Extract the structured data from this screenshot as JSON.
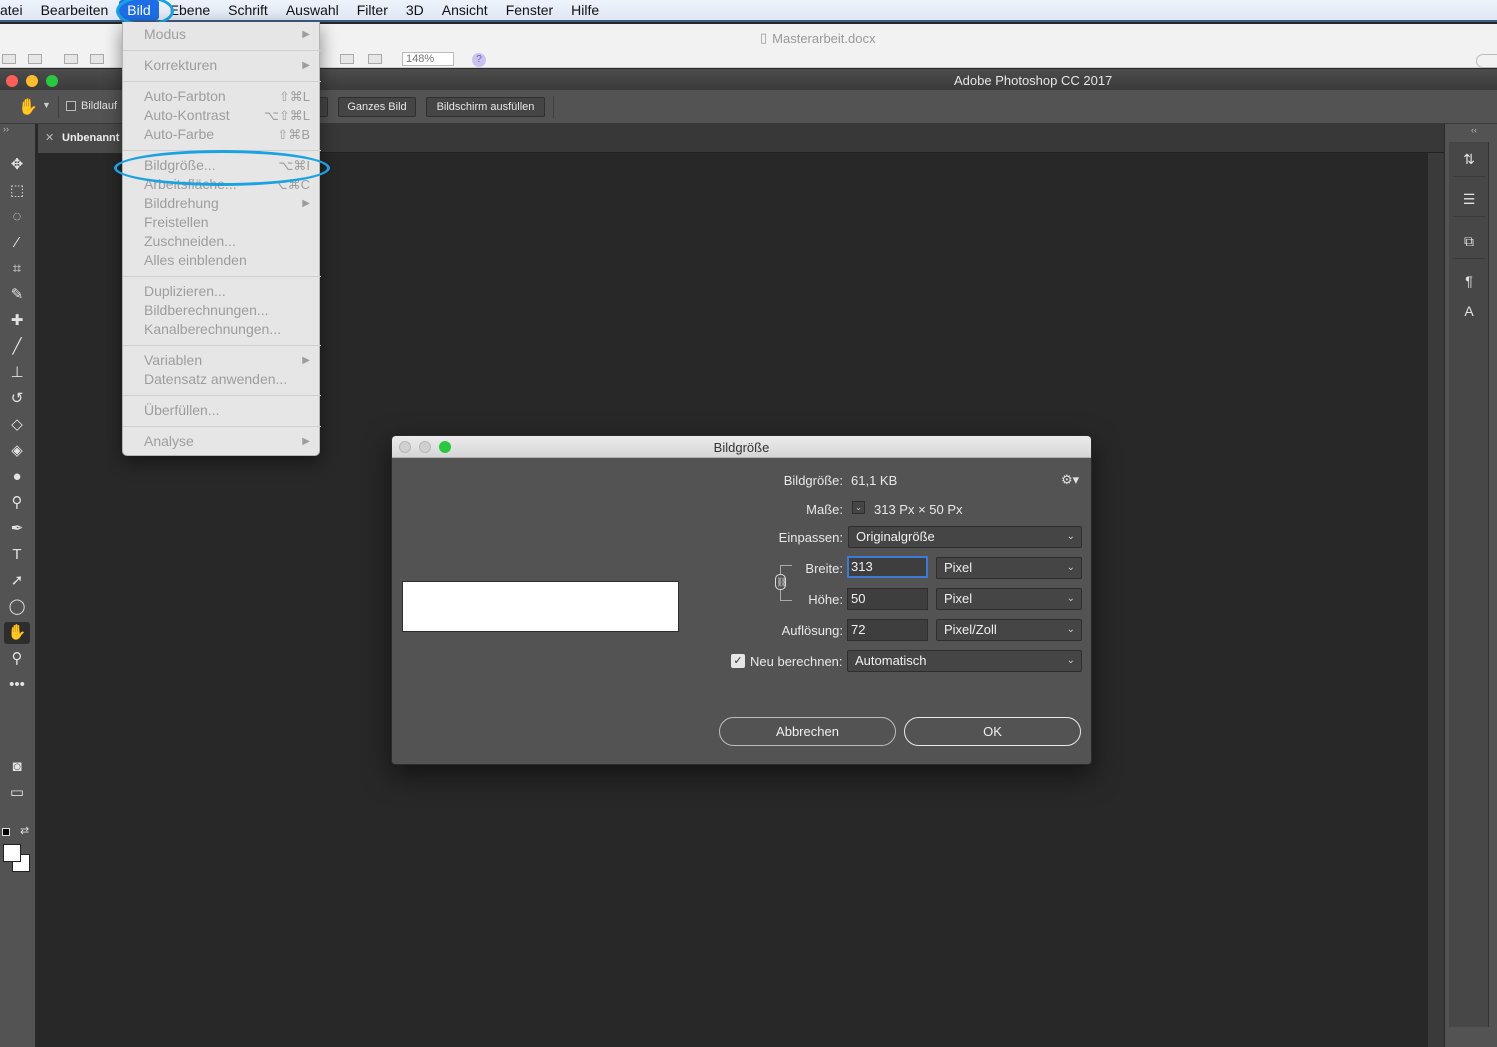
{
  "menubar": {
    "items": [
      "atei",
      "Bearbeiten",
      "Bild",
      "Ebene",
      "Schrift",
      "Auswahl",
      "Filter",
      "3D",
      "Ansicht",
      "Fenster",
      "Hilfe"
    ],
    "active": "Bild"
  },
  "word": {
    "doc_title": "Masterarbeit.docx",
    "zoom": "148%"
  },
  "photoshop": {
    "title": "Adobe Photoshop CC 2017"
  },
  "options_bar": {
    "bildlauf_label": "Bildlauf",
    "btn_ganzes_bild": "Ganzes Bild",
    "btn_bildschirm": "Bildschirm ausfüllen"
  },
  "document_tab": {
    "label": "Unbenannt"
  },
  "bild_menu": {
    "items": [
      {
        "label": "Modus",
        "submenu": true
      },
      {
        "label": "Korrekturen",
        "submenu": true
      },
      {
        "label": "Auto-Farbton",
        "shortcut": "⇧⌘L"
      },
      {
        "label": "Auto-Kontrast",
        "shortcut": "⌥⇧⌘L"
      },
      {
        "label": "Auto-Farbe",
        "shortcut": "⇧⌘B"
      },
      {
        "label": "Bildgröße...",
        "shortcut": "⌥⌘I"
      },
      {
        "label": "Arbeitsfläche...",
        "shortcut": "⌥⌘C"
      },
      {
        "label": "Bilddrehung",
        "submenu": true
      },
      {
        "label": "Freistellen"
      },
      {
        "label": "Zuschneiden..."
      },
      {
        "label": "Alles einblenden"
      },
      {
        "label": "Duplizieren..."
      },
      {
        "label": "Bildberechnungen..."
      },
      {
        "label": "Kanalberechnungen..."
      },
      {
        "label": "Variablen",
        "submenu": true
      },
      {
        "label": "Datensatz anwenden..."
      },
      {
        "label": "Überfüllen..."
      },
      {
        "label": "Analyse",
        "submenu": true
      }
    ]
  },
  "dialog": {
    "title": "Bildgröße",
    "bildgroesse_label": "Bildgröße:",
    "bildgroesse_value": "61,1 KB",
    "masse_label": "Maße:",
    "masse_value": "313 Px  ×  50 Px",
    "einpassen_label": "Einpassen:",
    "einpassen_value": "Originalgröße",
    "breite_label": "Breite:",
    "breite_value": "313",
    "breite_unit": "Pixel",
    "hoehe_label": "Höhe:",
    "hoehe_value": "50",
    "hoehe_unit": "Pixel",
    "aufloesung_label": "Auflösung:",
    "aufloesung_value": "72",
    "aufloesung_unit": "Pixel/Zoll",
    "neu_label": "Neu berechnen:",
    "neu_checked": true,
    "neu_value": "Automatisch",
    "cancel_label": "Abbrechen",
    "ok_label": "OK"
  },
  "colors": {
    "highlight_circle": "#1ca2e3",
    "menu_active": "#1d6ee6",
    "focus_ring": "#3d7ad6"
  }
}
